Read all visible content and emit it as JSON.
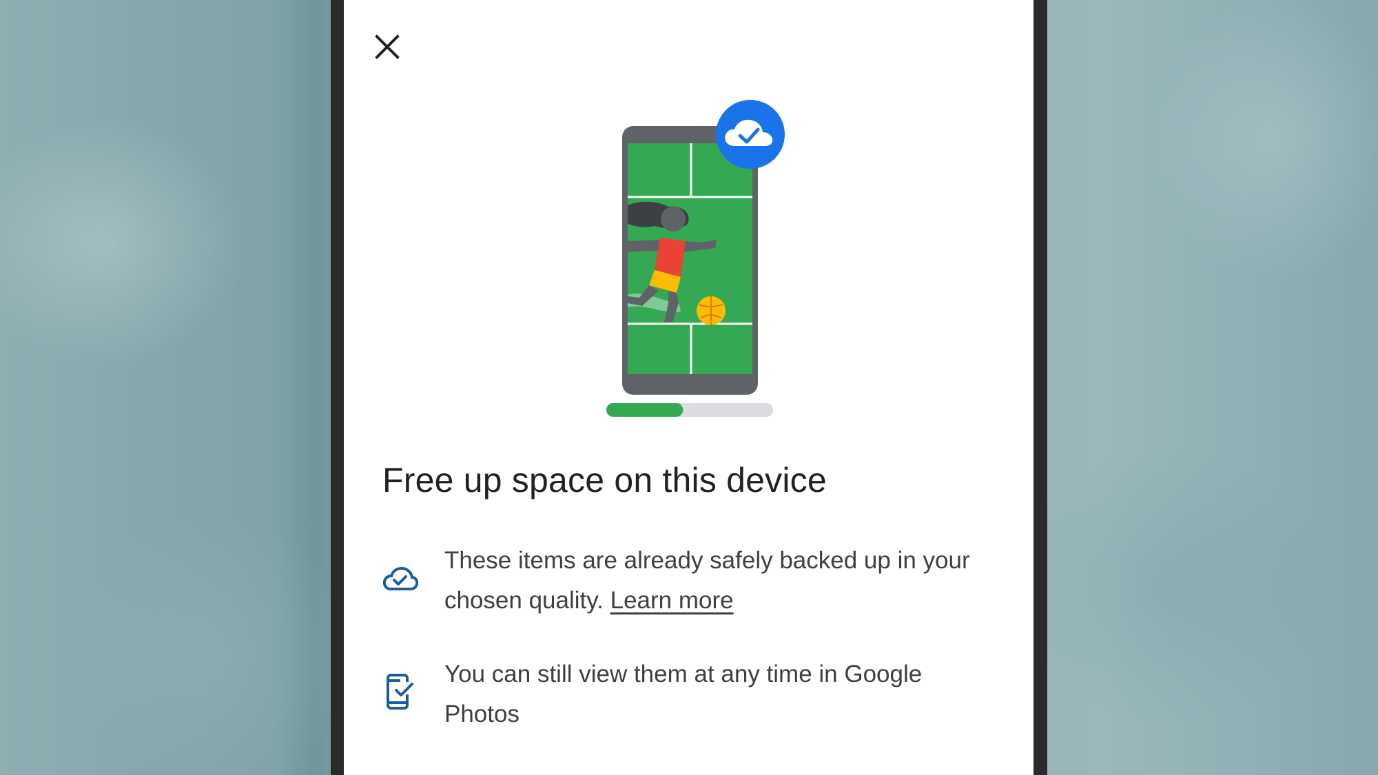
{
  "dialog": {
    "close_icon": "close-icon",
    "title": "Free up space on this device",
    "backup_progress": 0.46,
    "colors": {
      "accent_blue": "#1a73e8",
      "field_green": "#34a853",
      "device_grey": "#5f6368",
      "ball_yellow": "#fbbc04",
      "shirt_red": "#ea4335",
      "icon_blue": "#1a5d9c"
    },
    "items": [
      {
        "icon": "cloud-check-icon",
        "text": "These items are already safely backed up in your chosen quality.",
        "link": "Learn more"
      },
      {
        "icon": "phone-check-icon",
        "text": "You can still view them at any time in Google Photos"
      }
    ]
  }
}
